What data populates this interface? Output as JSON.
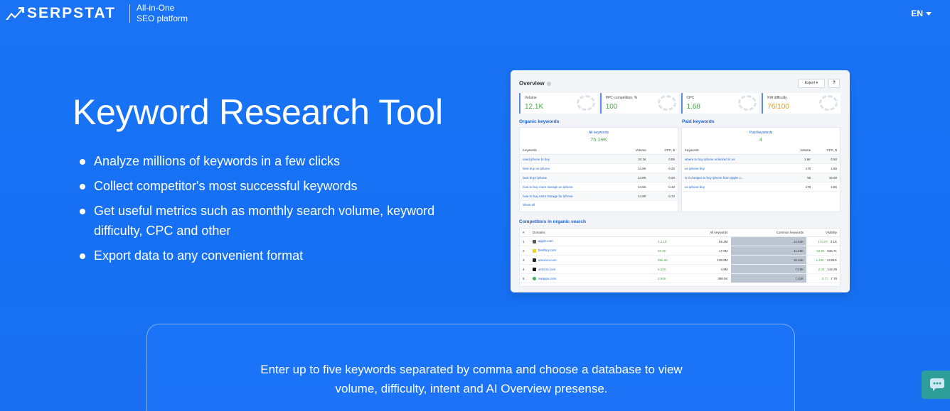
{
  "header": {
    "logo_text": "SERPSTAT",
    "tagline_line1": "All-in-One",
    "tagline_line2": "SEO platform",
    "language": "EN"
  },
  "hero": {
    "title": "Keyword Research Tool",
    "bullets": [
      "Analyze millions of keywords in a few clicks",
      "Collect competitor's most successful keywords",
      "Get useful metrics such as monthly search volume, keyword difficulty, CPC and other",
      "Export data to any convenient format"
    ]
  },
  "preview": {
    "overview_title": "Overview",
    "export_label": "Export ▾",
    "metrics": [
      {
        "label": "Volume",
        "value": "12.1K"
      },
      {
        "label": "PPC competition, %",
        "value": "100"
      },
      {
        "label": "CPC",
        "value": "1.68"
      },
      {
        "label": "KW difficulty",
        "value": "76/100"
      }
    ],
    "organic": {
      "title": "Organic keywords",
      "head": "All keywords",
      "count": "75.19K",
      "columns": [
        "Keywords",
        "Volume",
        "CPC, $"
      ],
      "rows": [
        [
          "used iphone to buy",
          "18.1K",
          "0.55"
        ],
        [
          "best buy on iphone",
          "14.8K",
          "0.20"
        ],
        [
          "best buys iphone",
          "14.8K",
          "0.20"
        ],
        [
          "how to buy more storage on iphone",
          "14.8K",
          "0.12"
        ],
        [
          "how to buy extra storage for iphone",
          "14.8K",
          "0.12"
        ]
      ],
      "show_all": "Show all"
    },
    "paid": {
      "title": "Paid keywords",
      "head": "Paid keywords",
      "count": "4",
      "columns": [
        "Keywords",
        "Volume",
        "CPC, $"
      ],
      "rows": [
        [
          "where to buy iphone unlocked in us",
          "1.6K",
          "0.50"
        ],
        [
          "us iphone buy",
          "170",
          "1.65"
        ],
        [
          "is it cheaper to buy iphone from apple o...",
          "50",
          "15.00"
        ],
        [
          "us iphone buy",
          "170",
          "1.65"
        ]
      ]
    },
    "competitors": {
      "title": "Competitors in organic search",
      "columns": [
        "#",
        "Domains",
        "All keywords",
        "Common keywords",
        "Visibility"
      ],
      "rows": [
        [
          "1",
          "apple.com",
          "2.1.1K",
          "55.2M",
          "12.53K",
          "170.07",
          "3.1K"
        ],
        [
          "2",
          "bestbuy.com",
          "56.9K",
          "17.9M",
          "11.46K",
          "92.95",
          "946.71"
        ],
        [
          "3",
          "amazon.com",
          "395.9K",
          "108.8M",
          "10.94K",
          "1.43K",
          "13.81K"
        ],
        [
          "4",
          "verizon.com",
          "6.22K",
          "4.9M",
          "7.42K",
          "2.46",
          "144.39"
        ],
        [
          "5",
          "swappa.com",
          "2.94K",
          "368.5K",
          "7.42K",
          "0.77",
          "7.78"
        ]
      ]
    }
  },
  "search": {
    "line1": "Enter up to five keywords separated by comma and choose a database to view",
    "line2": "volume, difficulty, intent and AI Overview presense."
  },
  "colors": {
    "background": "#1670f3",
    "chat_button": "#2e9e9a",
    "metric_green": "#4aa84a",
    "metric_orange": "#e89a1a"
  }
}
